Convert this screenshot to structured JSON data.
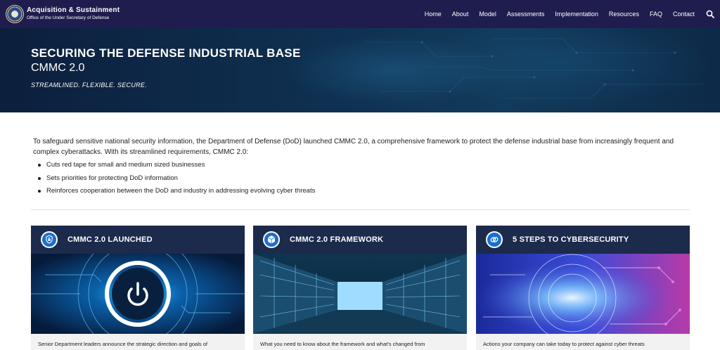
{
  "header": {
    "brand_title": "Acquisition & Sustainment",
    "brand_subtitle": "Office of the Under Secretary of Defense",
    "nav": [
      "Home",
      "About",
      "Model",
      "Assessments",
      "Implementation",
      "Resources",
      "FAQ",
      "Contact"
    ]
  },
  "hero": {
    "title": "SECURING THE DEFENSE INDUSTRIAL BASE",
    "subtitle": "CMMC 2.0",
    "tagline": "STREAMLINED. FLEXIBLE. SECURE."
  },
  "intro": {
    "paragraph": "To safeguard sensitive national security information, the Department of Defense (DoD) launched CMMC 2.0, a comprehensive framework to protect the defense industrial base from increasingly frequent and complex cyberattacks. With its streamlined requirements, CMMC 2.0:",
    "bullets": [
      "Cuts red tape for small and medium sized businesses",
      "Sets priorities for protecting DoD information",
      "Reinforces cooperation between the DoD and industry in addressing evolving cyber threats"
    ]
  },
  "cards": [
    {
      "title": "CMMC 2.0 LAUNCHED",
      "icon": "shield-lock-icon",
      "text": "Senior Department leaders announce the strategic direction and goals of"
    },
    {
      "title": "CMMC 2.0 FRAMEWORK",
      "icon": "cube-icon",
      "text": "What you need to know about the framework and what's changed from"
    },
    {
      "title": "5 STEPS TO CYBERSECURITY",
      "icon": "link-icon",
      "text": "Actions your company can take today to protect against cyber threats"
    }
  ],
  "colors": {
    "nav_bg": "#1f1d4e",
    "card_head": "#1c2a4c",
    "icon_blue": "#1a6fd0",
    "hero_bg": "#0f3050"
  }
}
